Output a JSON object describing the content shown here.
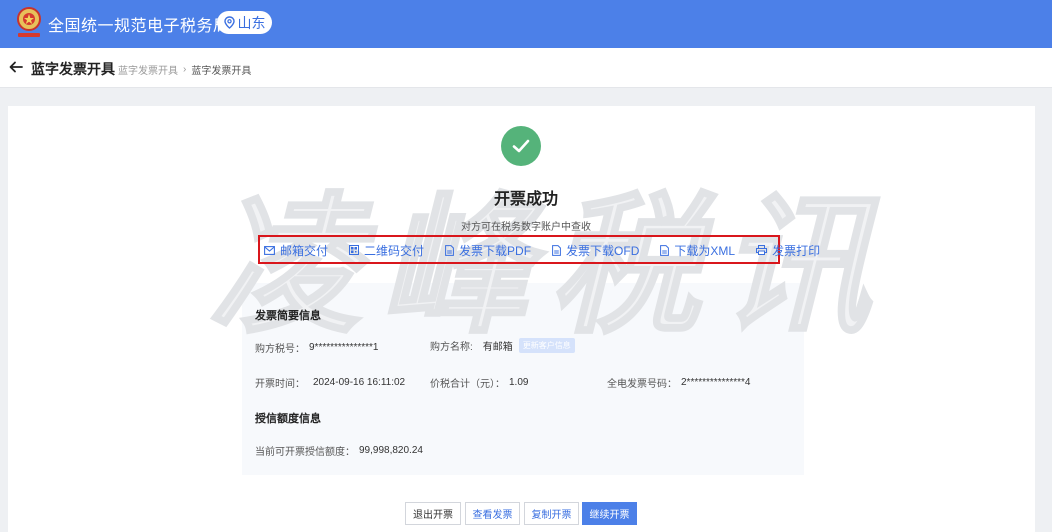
{
  "header": {
    "site_title": "全国统一规范电子税务局",
    "region": "山东"
  },
  "subheader": {
    "page_title": "蓝字发票开具",
    "breadcrumb": [
      "蓝字发票开具",
      "蓝字发票开具"
    ]
  },
  "result": {
    "title": "开票成功",
    "subtitle": "对方可在税务数字账户中查收",
    "actions": [
      {
        "label": "邮箱交付",
        "icon": "mail-icon"
      },
      {
        "label": "二维码交付",
        "icon": "qrcode-icon"
      },
      {
        "label": "发票下载PDF",
        "icon": "document-icon"
      },
      {
        "label": "发票下载OFD",
        "icon": "document-icon"
      },
      {
        "label": "下载为XML",
        "icon": "document-icon"
      },
      {
        "label": "发票打印",
        "icon": "printer-icon"
      }
    ]
  },
  "watermark": "凌峰税讯",
  "invoice_summary": {
    "heading": "发票简要信息",
    "buyer_tax_id_label": "购方税号：",
    "buyer_tax_id": "9***************1",
    "buyer_name_label": "购方名称:",
    "buyer_name": "有邮箱",
    "update_customer_label": "更新客户信息",
    "issue_time_label": "开票时间：",
    "issue_time": "2024-09-16 16:11:02",
    "total_label": "价税合计（元）：",
    "total": "1.09",
    "invoice_no_label": "全电发票号码：",
    "invoice_no": "2***************4"
  },
  "credit": {
    "heading": "授信额度信息",
    "available_label": "当前可开票授信额度：",
    "available": "99,998,820.24"
  },
  "buttons": {
    "exit": "退出开票",
    "view": "查看发票",
    "copy": "复制开票",
    "continue": "继续开票"
  },
  "colors": {
    "header_blue": "#4c80e8",
    "link_blue": "#3a6fe0",
    "success_green": "#55b37a",
    "highlight_red": "#d9161c"
  }
}
